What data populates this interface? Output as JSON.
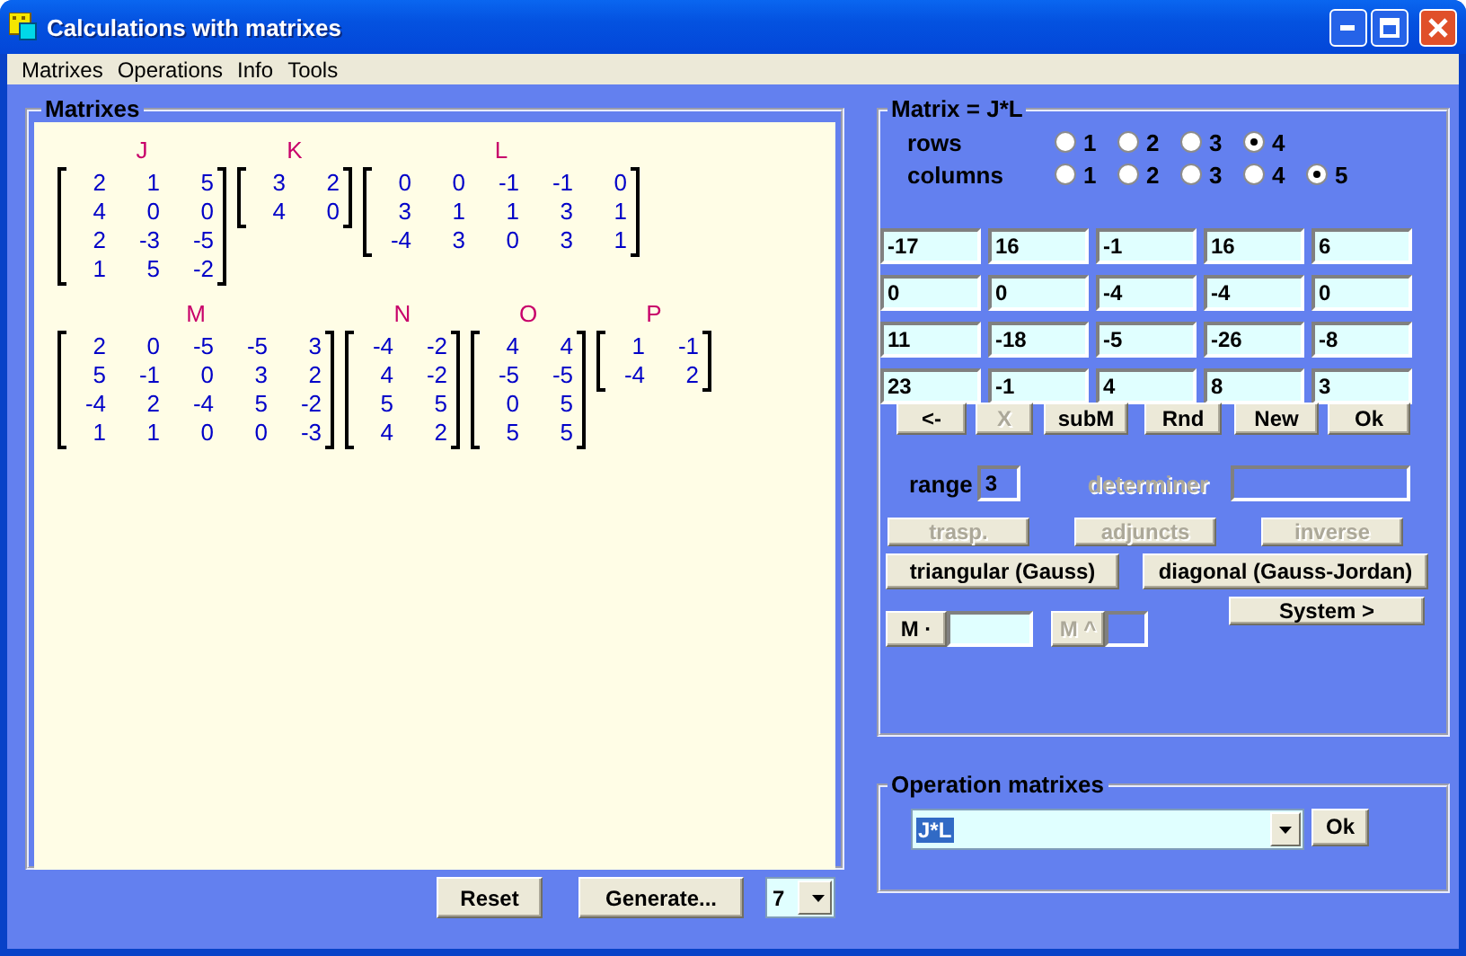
{
  "window": {
    "title": "Calculations with matrixes"
  },
  "menu": [
    "Matrixes",
    "Operations",
    "Info",
    "Tools"
  ],
  "matrices_panel": {
    "title": "Matrixes",
    "lines": [
      [
        {
          "name": "J",
          "rows": [
            [
              "2",
              "1",
              "5"
            ],
            [
              "4",
              "0",
              "0"
            ],
            [
              "2",
              "-3",
              "-5"
            ],
            [
              "1",
              "5",
              "-2"
            ]
          ]
        },
        {
          "name": "K",
          "rows": [
            [
              "3",
              "2"
            ],
            [
              "4",
              "0"
            ]
          ]
        },
        {
          "name": "L",
          "rows": [
            [
              "0",
              "0",
              "-1",
              "-1",
              "0"
            ],
            [
              "3",
              "1",
              "1",
              "3",
              "1"
            ],
            [
              "-4",
              "3",
              "0",
              "3",
              "1"
            ]
          ]
        }
      ],
      [
        {
          "name": "M",
          "rows": [
            [
              "2",
              "0",
              "-5",
              "-5",
              "3"
            ],
            [
              "5",
              "-1",
              "0",
              "3",
              "2"
            ],
            [
              "-4",
              "2",
              "-4",
              "5",
              "-2"
            ],
            [
              "1",
              "1",
              "0",
              "0",
              "-3"
            ]
          ]
        },
        {
          "name": "N",
          "rows": [
            [
              "-4",
              "-2"
            ],
            [
              "4",
              "-2"
            ],
            [
              "5",
              "5"
            ],
            [
              "4",
              "2"
            ]
          ]
        },
        {
          "name": "O",
          "rows": [
            [
              "4",
              "4"
            ],
            [
              "-5",
              "-5"
            ],
            [
              "0",
              "5"
            ],
            [
              "5",
              "5"
            ]
          ]
        },
        {
          "name": "P",
          "rows": [
            [
              "1",
              "-1"
            ],
            [
              "-4",
              "2"
            ]
          ]
        }
      ]
    ]
  },
  "bottom_bar": {
    "buttons": [
      {
        "label": "Reset"
      },
      {
        "label": "Generate..."
      }
    ],
    "count": "7"
  },
  "editor": {
    "title": "Matrix = J*L",
    "rows_label": "rows",
    "row_options": [
      {
        "label": "1",
        "selected": false
      },
      {
        "label": "2",
        "selected": false
      },
      {
        "label": "3",
        "selected": false
      },
      {
        "label": "4",
        "selected": true
      }
    ],
    "columns_label": "columns",
    "column_options": [
      {
        "label": "1",
        "selected": false
      },
      {
        "label": "2",
        "selected": false
      },
      {
        "label": "3",
        "selected": false
      },
      {
        "label": "4",
        "selected": false
      },
      {
        "label": "5",
        "selected": true
      }
    ],
    "cells": [
      [
        "-17",
        "16",
        "-1",
        "16",
        "6"
      ],
      [
        "0",
        "0",
        "-4",
        "-4",
        "0"
      ],
      [
        "11",
        "-18",
        "-5",
        "-26",
        "-8"
      ],
      [
        "23",
        "-1",
        "4",
        "8",
        "3"
      ]
    ],
    "buttons": [
      {
        "label": "<-",
        "disabled": false
      },
      {
        "label": "X",
        "disabled": true
      },
      {
        "label": "subM",
        "disabled": false
      },
      {
        "label": "Rnd",
        "disabled": false
      },
      {
        "label": "New",
        "disabled": false
      },
      {
        "label": "Ok",
        "disabled": false
      }
    ],
    "range_label": "range",
    "range_value": "3",
    "determiner_label": "determiner",
    "determiner_disabled": true,
    "operation_buttons": [
      {
        "label": "trasp.",
        "disabled": true
      },
      {
        "label": "adjuncts",
        "disabled": true
      },
      {
        "label": "inverse",
        "disabled": true
      }
    ],
    "gauss_buttons": [
      {
        "label": "triangular (Gauss)",
        "disabled": false
      },
      {
        "label": "diagonal (Gauss-Jordan)",
        "disabled": false
      }
    ],
    "multiply_button": {
      "label": "M ·",
      "disabled": false
    },
    "power_button": {
      "label": "M ^",
      "disabled": true
    },
    "system_button": {
      "label": "System >",
      "disabled": false
    }
  },
  "operations": {
    "title": "Operation matrixes",
    "value": "J*L",
    "ok": "Ok"
  }
}
